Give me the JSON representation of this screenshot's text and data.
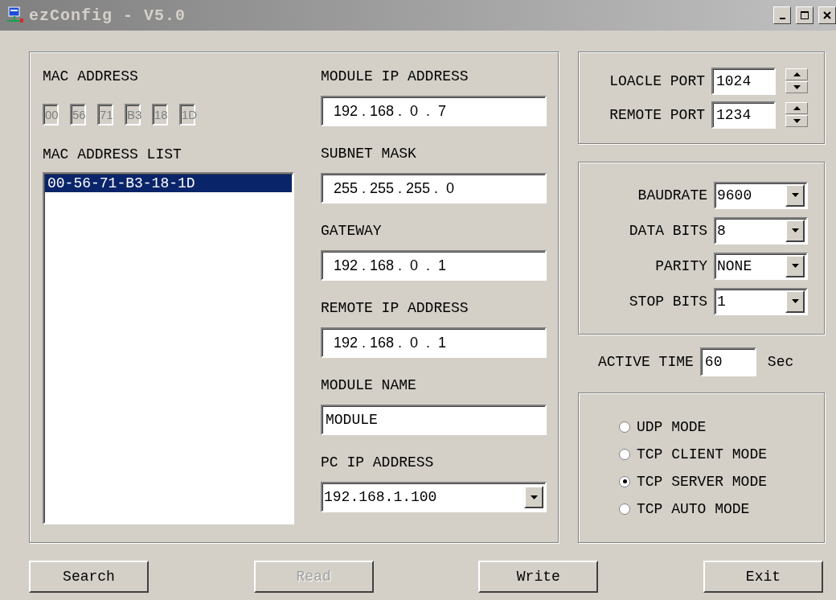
{
  "window": {
    "title": "ezConfig - V5.0"
  },
  "mac_address": {
    "label": "MAC ADDRESS",
    "disabled": true,
    "octets": [
      "00",
      "56",
      "71",
      "B3",
      "18",
      "1D"
    ]
  },
  "mac_list": {
    "label": "MAC ADDRESS LIST",
    "items": [
      {
        "text": "00-56-71-B3-18-1D",
        "selected": true
      }
    ]
  },
  "fields": [
    {
      "kind": "ip",
      "label": "MODULE IP ADDRESS",
      "value": "192 . 168 .  0  .  7"
    },
    {
      "kind": "ip",
      "label": "SUBNET MASK",
      "value": "255 . 255 . 255 .  0"
    },
    {
      "kind": "ip",
      "label": "GATEWAY",
      "value": "192 . 168 .  0  .  1"
    },
    {
      "kind": "ip",
      "label": "REMOTE IP ADDRESS",
      "value": "192 . 168 .  0  .  1"
    },
    {
      "kind": "text",
      "label": "MODULE NAME",
      "value": "MODULE"
    },
    {
      "kind": "combo",
      "label": "PC IP ADDRESS",
      "value": "192.168.1.100"
    }
  ],
  "ports": [
    {
      "label": "LOACLE PORT",
      "value": "1024"
    },
    {
      "label": "REMOTE PORT",
      "value": "1234"
    }
  ],
  "serial": [
    {
      "label": "BAUDRATE",
      "value": "9600"
    },
    {
      "label": "DATA BITS",
      "value": "8"
    },
    {
      "label": "PARITY",
      "value": "NONE"
    },
    {
      "label": "STOP BITS",
      "value": "1"
    }
  ],
  "active_time": {
    "label": "ACTIVE TIME",
    "value": "60",
    "unit": "Sec"
  },
  "modes": [
    {
      "label": "UDP MODE",
      "selected": false
    },
    {
      "label": "TCP CLIENT MODE",
      "selected": false
    },
    {
      "label": "TCP SERVER MODE",
      "selected": true
    },
    {
      "label": "TCP AUTO MODE",
      "selected": false
    }
  ],
  "buttons": [
    {
      "label": "Search",
      "disabled": false
    },
    {
      "label": "Read",
      "disabled": true
    },
    {
      "label": "Write",
      "disabled": false
    },
    {
      "label": "Exit",
      "disabled": false
    }
  ]
}
